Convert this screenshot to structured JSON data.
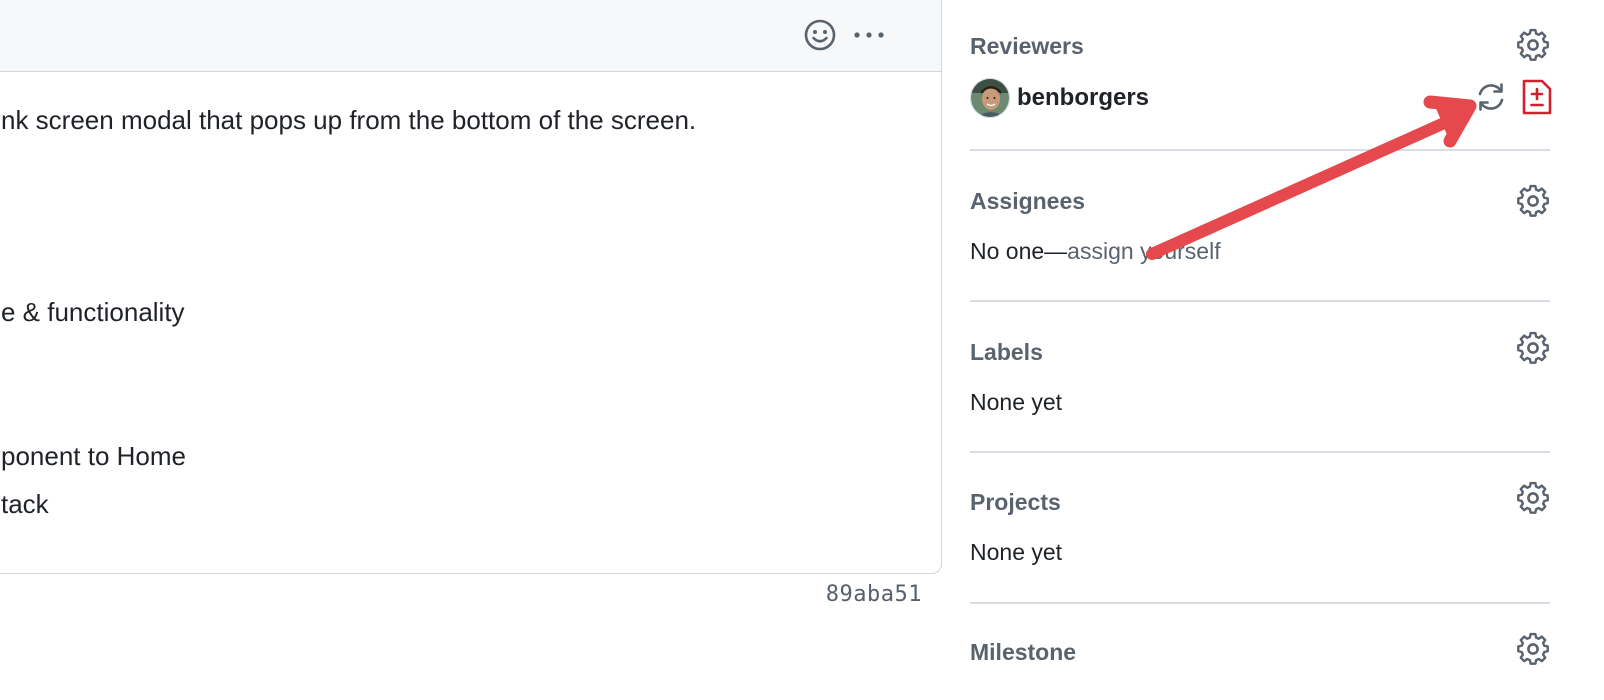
{
  "comment": {
    "body_lines": [
      "nk screen modal that pops up from the bottom of the screen.",
      "e & functionality",
      "ponent to Home",
      "tack"
    ],
    "commit_sha": "89aba51"
  },
  "sidebar": {
    "reviewers": {
      "title": "Reviewers",
      "reviewer_name": "benborgers"
    },
    "assignees": {
      "title": "Assignees",
      "value_prefix": "No one—",
      "assign_link": "assign yourself"
    },
    "labels": {
      "title": "Labels",
      "value": "None yet"
    },
    "projects": {
      "title": "Projects",
      "value": "None yet"
    },
    "milestone": {
      "title": "Milestone"
    }
  },
  "icons": {
    "emoji": "smiley-icon",
    "more": "kebab-horizontal-icon",
    "gear": "gear-icon",
    "rerequest": "sync-icon",
    "diff": "file-diff-icon"
  },
  "colors": {
    "annotation_arrow": "#e5484d",
    "diff_icon": "#cf222e",
    "muted_text": "#59636e",
    "border": "#d0d7de"
  }
}
